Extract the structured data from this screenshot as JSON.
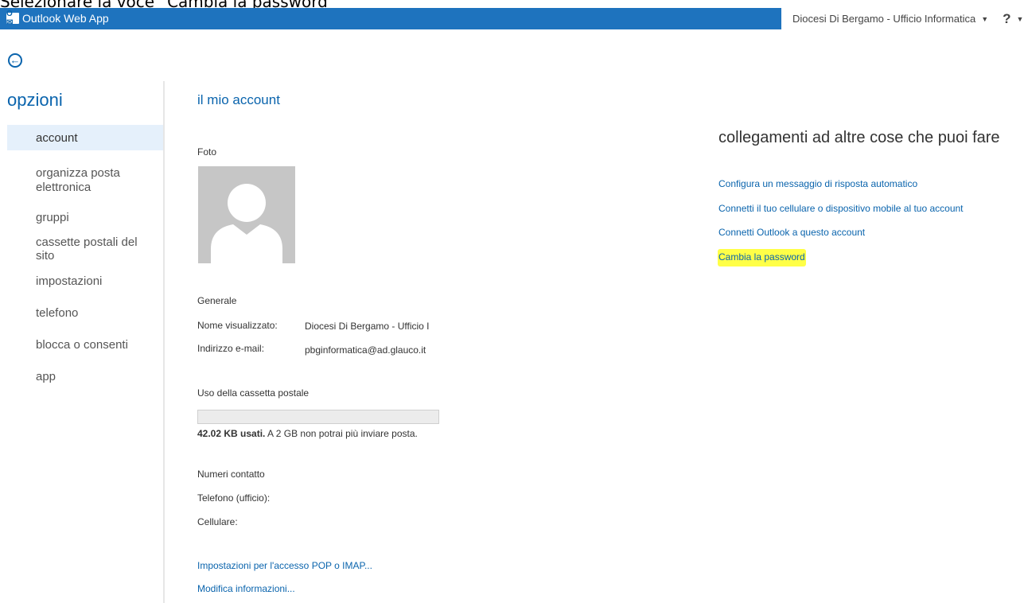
{
  "caption": "Selezionare la voce “Cambia la password”",
  "topbar": {
    "app_title": "Outlook Web App",
    "logo_glyph": "O✉",
    "account_name": "Diocesi Di Bergamo - Ufficio Informatica",
    "help_glyph": "?",
    "accent": "#1e73be"
  },
  "nav": {
    "title": "opzioni",
    "items": [
      {
        "label": "account"
      },
      {
        "label": "organizza posta elettronica"
      },
      {
        "label": "gruppi"
      },
      {
        "label": "cassette postali del sito"
      },
      {
        "label": "impostazioni"
      },
      {
        "label": "telefono"
      },
      {
        "label": "blocca o consenti"
      },
      {
        "label": "app"
      }
    ]
  },
  "main": {
    "title": "il mio account",
    "photo_label": "Foto",
    "general": {
      "heading": "Generale",
      "display_name_label": "Nome visualizzato:",
      "display_name_value": "Diocesi Di Bergamo - Ufficio Informatica",
      "email_label": "Indirizzo e-mail:",
      "email_value": "pbginformatica@ad.glauco.it"
    },
    "mailbox": {
      "heading": "Uso della cassetta postale",
      "used_fraction": 0,
      "used_text": "42.02 KB usati.",
      "limit_text": "A 2 GB non potrai più inviare posta."
    },
    "contacts": {
      "heading": "Numeri contatto",
      "office_phone_label": "Telefono (ufficio):",
      "mobile_label": "Cellulare:"
    },
    "pop_imap_link": "Impostazioni per l'accesso POP o IMAP...",
    "edit_link": "Modifica informazioni..."
  },
  "links": {
    "title": "collegamenti ad altre cose che puoi fare",
    "auto_reply": "Configura un messaggio di risposta automatico",
    "connect_mobile": "Connetti il tuo cellulare o dispositivo mobile al tuo account",
    "connect_outlook": "Connetti Outlook a questo account",
    "change_password": "Cambia la password",
    "highlight_color": "#ffff47"
  }
}
